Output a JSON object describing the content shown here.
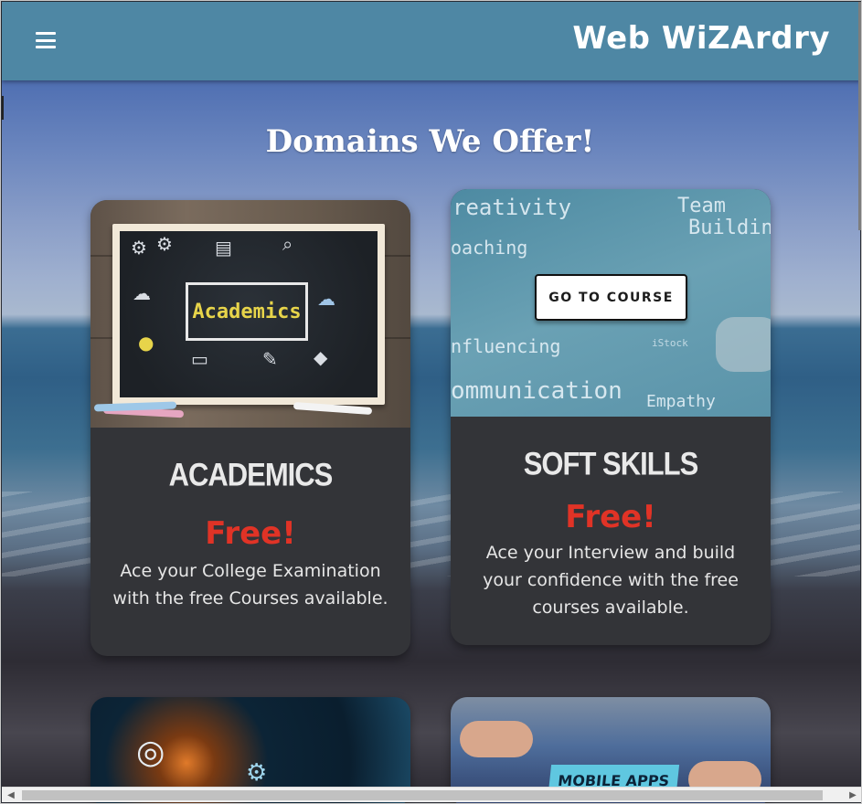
{
  "header": {
    "brand": "Web WiZArdry",
    "menu_icon": "hamburger-menu-icon"
  },
  "section": {
    "title": "Domains We Offer!"
  },
  "cards": [
    {
      "image_label": "Academics",
      "title": "ACADEMICS",
      "price": "Free!",
      "description": "Ace your College Examination with the free Courses available."
    },
    {
      "image_words": [
        "reativity",
        "Team",
        "Building",
        "oaching",
        "nfluencing",
        "ommunication",
        "Empathy",
        "iStock"
      ],
      "button": "GO TO COURSE",
      "title": "SOFT SKILLS",
      "price": "Free!",
      "description": "Ace your Interview and build your confidence with the free courses available."
    },
    {
      "image_icon": "technology-globe-icon"
    },
    {
      "image_label": "MOBILE APPS"
    }
  ],
  "colors": {
    "header_bg": "#4e87a4",
    "card_bg": "#333438",
    "price": "#e03326"
  }
}
